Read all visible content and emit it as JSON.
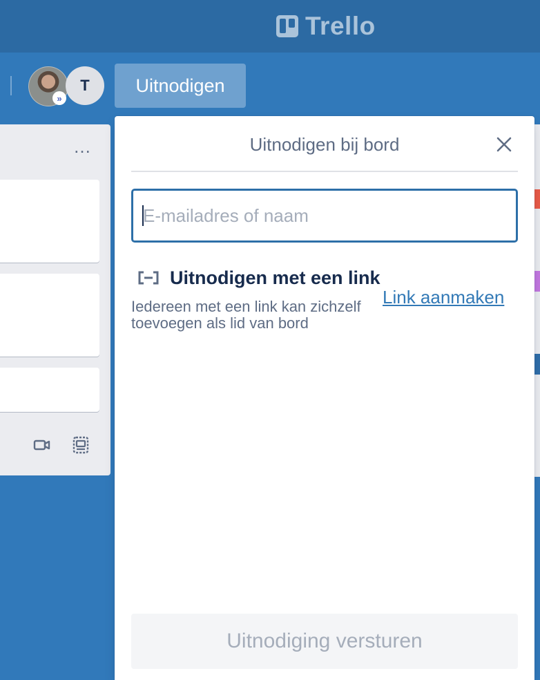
{
  "header": {
    "logo_text": "Trello",
    "logo_icon": "trello-board-icon"
  },
  "members": {
    "avatar_initial": "T",
    "admin_badge": "»",
    "invite_button_label": "Uitnodigen"
  },
  "list": {
    "menu_label": "…",
    "footer_icons": [
      "video-icon",
      "card-template-icon"
    ]
  },
  "invite_popover": {
    "title": "Uitnodigen bij bord",
    "close_icon": "close-icon",
    "input_value": "",
    "input_placeholder": "E-mailadres of naam",
    "link_section_title": "Uitnodigen met een link",
    "link_section_icon": "link-icon",
    "link_description": "Iedereen met een link kan zichzelf toevoegen als lid van bord",
    "create_link_label": "Link aanmaken",
    "send_button_label": "Uitnodiging versturen"
  },
  "colors": {
    "board_background": "#3179ba",
    "header_background": "#2c6aa3",
    "input_focus_border": "#2d6fa8",
    "link_color": "#3279b6",
    "disabled_text": "#a5adba"
  }
}
